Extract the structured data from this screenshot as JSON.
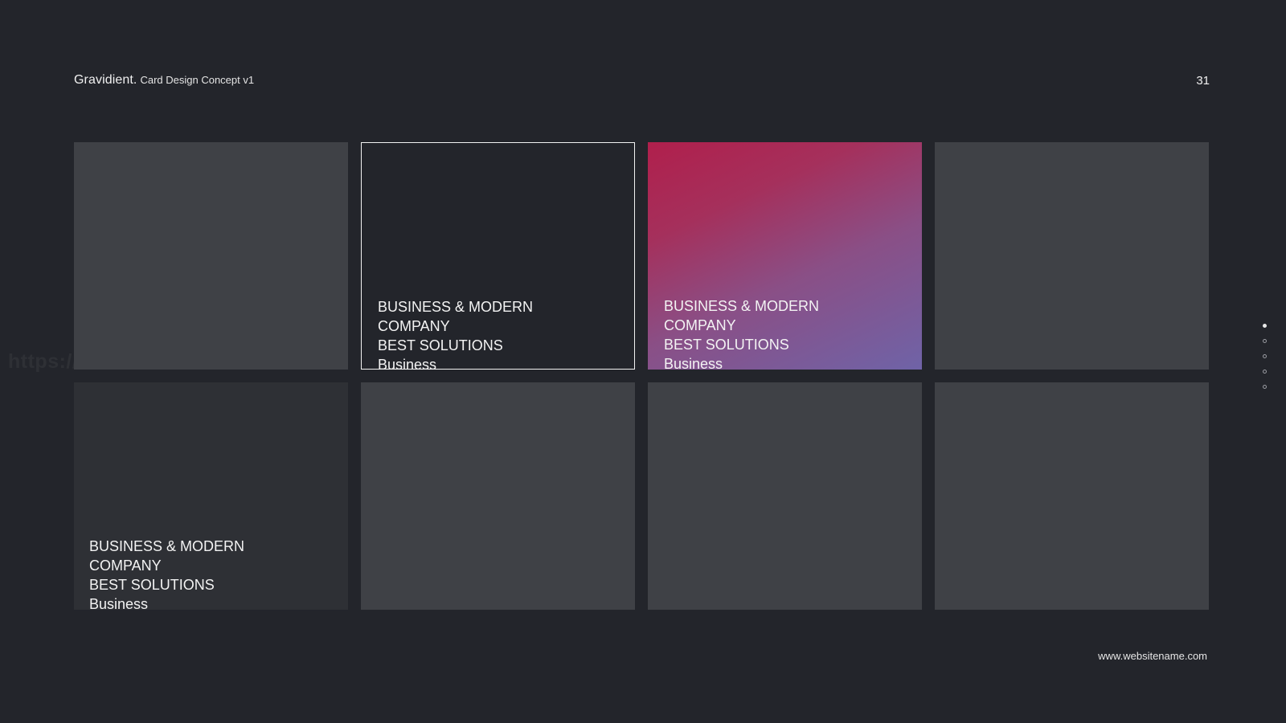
{
  "header": {
    "brand": "Gravidient.",
    "subtitle": "Card Design Concept v1",
    "page_number": "31"
  },
  "watermark": "https://",
  "cards": [
    {
      "style": "plain",
      "lines": []
    },
    {
      "style": "outlined",
      "lines": [
        "BUSINESS & MODERN",
        "COMPANY",
        "BEST SOLUTIONS",
        "Business"
      ]
    },
    {
      "style": "gradient",
      "lines": [
        "BUSINESS & MODERN",
        "COMPANY",
        "BEST SOLUTIONS",
        "Business"
      ],
      "gradient_colors": [
        "#b01f4c",
        "#6f63a7"
      ]
    },
    {
      "style": "plain",
      "lines": []
    },
    {
      "style": "dark",
      "lines": [
        "BUSINESS & MODERN",
        "COMPANY",
        "BEST SOLUTIONS",
        "Business"
      ]
    },
    {
      "style": "plain",
      "lines": []
    },
    {
      "style": "plain",
      "lines": []
    },
    {
      "style": "plain",
      "lines": []
    }
  ],
  "pagination": {
    "total": 5,
    "active_index": 0
  },
  "footer": {
    "url": "www.websitename.com"
  },
  "colors": {
    "background": "#23252b",
    "card": "#3f4146",
    "card_dark": "#2e3035",
    "text": "#f3f3f3"
  }
}
